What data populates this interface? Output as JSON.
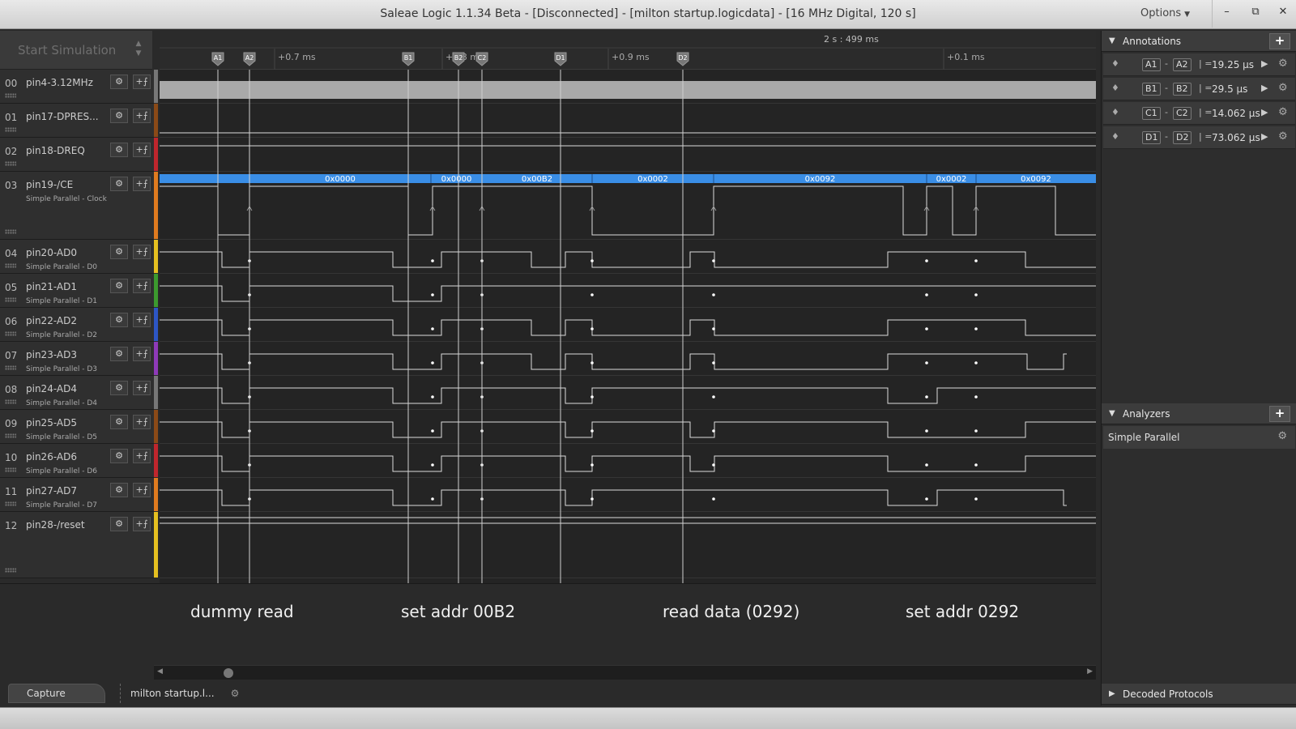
{
  "window": {
    "title": "Saleae Logic 1.1.34 Beta - [Disconnected] - [milton startup.logicdata] - [16 MHz Digital, 120 s]",
    "options_label": "Options",
    "minimize": "–",
    "restore": "⧉",
    "close": "✕"
  },
  "sim": {
    "label": "Start Simulation"
  },
  "ruler": {
    "timestamp": "2 s : 499 ms",
    "ticks": [
      "+0.7 ms",
      "+0.8 ms",
      "+0.9 ms",
      "+0.1 ms"
    ],
    "markers": [
      "A1",
      "A2",
      "B1",
      "B2",
      "C2",
      "D1",
      "D2"
    ]
  },
  "channels": [
    {
      "num": "00",
      "name": "pin4-3.12MHz",
      "sub": "",
      "color": "#777777"
    },
    {
      "num": "01",
      "name": "pin17-DPRES...",
      "sub": "",
      "color": "#8b4a17"
    },
    {
      "num": "02",
      "name": "pin18-DREQ",
      "sub": "",
      "color": "#c0262d"
    },
    {
      "num": "03",
      "name": "pin19-/CE",
      "sub": "Simple Parallel - Clock",
      "color": "#e07b1f"
    },
    {
      "num": "04",
      "name": "pin20-AD0",
      "sub": "Simple Parallel - D0",
      "color": "#e6c020"
    },
    {
      "num": "05",
      "name": "pin21-AD1",
      "sub": "Simple Parallel - D1",
      "color": "#3c9a2e"
    },
    {
      "num": "06",
      "name": "pin22-AD2",
      "sub": "Simple Parallel - D2",
      "color": "#2d56c4"
    },
    {
      "num": "07",
      "name": "pin23-AD3",
      "sub": "Simple Parallel - D3",
      "color": "#8e3ab8"
    },
    {
      "num": "08",
      "name": "pin24-AD4",
      "sub": "Simple Parallel - D4",
      "color": "#777777"
    },
    {
      "num": "09",
      "name": "pin25-AD5",
      "sub": "Simple Parallel - D5",
      "color": "#8b4a17"
    },
    {
      "num": "10",
      "name": "pin26-AD6",
      "sub": "Simple Parallel - D6",
      "color": "#c0262d"
    },
    {
      "num": "11",
      "name": "pin27-AD7",
      "sub": "Simple Parallel - D7",
      "color": "#e07b1f"
    },
    {
      "num": "12",
      "name": "pin28-/reset",
      "sub": "",
      "color": "#e6c020"
    }
  ],
  "decoded": [
    "0x0000",
    "0x0000",
    "0x00B2",
    "0x0002",
    "0x0092",
    "0x0002",
    "0x0092"
  ],
  "notes": [
    "dummy read",
    "set addr 00B2",
    "read data (0292)",
    "set addr 0292"
  ],
  "tabs": {
    "capture": "Capture",
    "file": "milton startup.l..."
  },
  "annotations": {
    "title": "Annotations",
    "items": [
      {
        "a": "A1",
        "b": "A2",
        "value": "19.25 µs"
      },
      {
        "a": "B1",
        "b": "B2",
        "value": "29.5 µs"
      },
      {
        "a": "C1",
        "b": "C2",
        "value": "14.062 µs"
      },
      {
        "a": "D1",
        "b": "D2",
        "value": "73.062 µs"
      }
    ]
  },
  "analyzers": {
    "title": "Analyzers",
    "items": [
      "Simple Parallel"
    ]
  },
  "decoded_protocols": {
    "title": "Decoded Protocols"
  }
}
